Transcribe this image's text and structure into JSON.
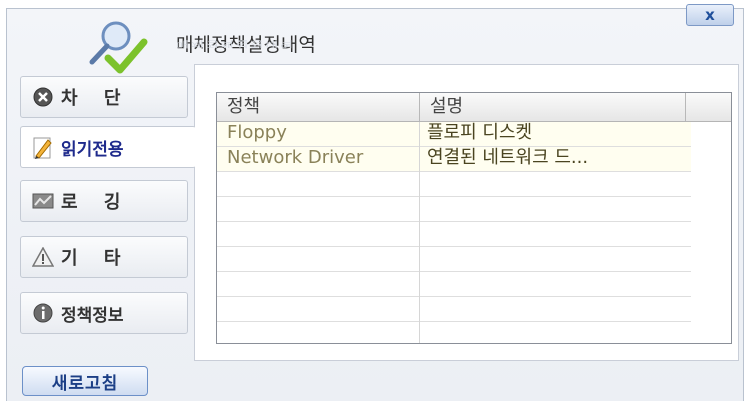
{
  "window": {
    "title": "매체정책설정내역",
    "close_label": "x"
  },
  "sidebar": {
    "items": [
      {
        "label": "차 단",
        "icon": "block-icon",
        "active": false
      },
      {
        "label": "읽기전용",
        "icon": "pencil-icon",
        "active": true
      },
      {
        "label": "로 깅",
        "icon": "log-icon",
        "active": false
      },
      {
        "label": "기 타",
        "icon": "warning-icon",
        "active": false
      },
      {
        "label": "정책정보",
        "icon": "info-icon",
        "active": false
      }
    ]
  },
  "table": {
    "columns": [
      "정책",
      "설명"
    ],
    "rows": [
      {
        "policy": "Floppy",
        "description": "플로피 디스켓"
      },
      {
        "policy": "Network Driver",
        "description": "연결된 네트워크 드..."
      }
    ]
  },
  "footer": {
    "refresh_label": "새로고침"
  },
  "colors": {
    "accent": "#1e2a8c",
    "row_highlight": "#fffef0"
  }
}
